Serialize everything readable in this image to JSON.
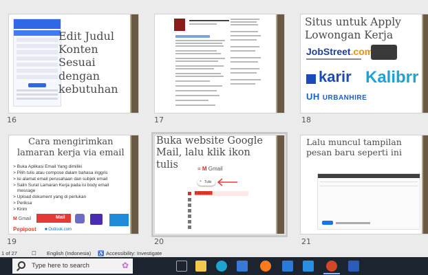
{
  "slides": [
    {
      "num": "16",
      "title_lines": [
        "Edit Judul",
        "Konten",
        "Sesuai",
        "dengan",
        "kebutuhan"
      ]
    },
    {
      "num": "17"
    },
    {
      "num": "18",
      "title_lines": [
        "Situs untuk Apply",
        "Lowongan Kerja"
      ],
      "logos": {
        "jobstreet": "JobStreet",
        "jobstreet_dot": ".com",
        "karir": "karir",
        "kalibrr": "Kalibrr",
        "urbanhire": "URBANHIRE"
      }
    },
    {
      "num": "19",
      "title_lines": [
        "Cara mengirimkan",
        "lamaran kerja via email"
      ],
      "bullets": [
        "Buka Aplikasi Email Yang dimiliki",
        "Pilih tulis atau compose dalam bahasa inggris",
        "isi alamat email perusahaan dan subjek email",
        "Salin Surat Lamaran Kerja pada isi body email",
        "message",
        "Upload dokument yang di perlukan",
        "Periksa",
        "Kirim"
      ],
      "logos": {
        "gmail": "Gmail",
        "zoho": "Mail",
        "pepipost": "Pepipost",
        "outlook": "Outlook.com"
      }
    },
    {
      "num": "20",
      "title_lines": [
        "Buka website Google",
        "Mail, lalu klik ikon",
        "tulis"
      ],
      "gmail_label": "Gmail",
      "compose_label": "Tulis"
    },
    {
      "num": "21",
      "title_lines": [
        "Lalu muncul tampilan",
        "pesan baru seperti ini"
      ]
    }
  ],
  "status": {
    "slide_count": "1 of 27",
    "language": "English (Indonesia)",
    "accessibility": "Accessibility: Investigate"
  },
  "taskbar": {
    "search_placeholder": "Type here to search"
  },
  "colors": {
    "slide_bar": "#6a5a45",
    "taskbar": "#1c2430",
    "selection": "#c8c8c8"
  }
}
